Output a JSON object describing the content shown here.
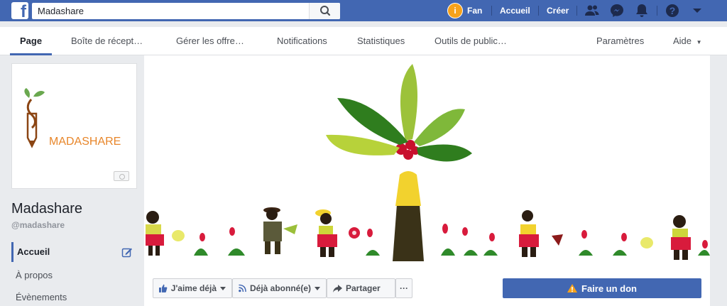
{
  "topbar": {
    "search_value": "Madashare",
    "fan_label": "Fan",
    "home_label": "Accueil",
    "create_label": "Créer"
  },
  "tabs": [
    {
      "label": "Page"
    },
    {
      "label": "Boîte de récept…"
    },
    {
      "label": "Gérer les offre…"
    },
    {
      "label": "Notifications"
    },
    {
      "label": "Statistiques"
    },
    {
      "label": "Outils de public…"
    },
    {
      "label": "Paramètres"
    },
    {
      "label": "Aide"
    }
  ],
  "profile": {
    "logo_text": "MADASHARE",
    "name": "Madashare",
    "handle": "@madashare"
  },
  "sidebar": {
    "items": [
      {
        "label": "Accueil"
      },
      {
        "label": "À propos"
      },
      {
        "label": "Évènements"
      }
    ]
  },
  "actions": {
    "like_label": "J'aime déjà",
    "follow_label": "Déjà abonné(e)",
    "share_label": "Partager",
    "more_label": "···",
    "donate_label": "Faire un don"
  },
  "colors": {
    "brand": "#4267b2",
    "logo_orange": "#e8862a",
    "warning": "#f7a21b"
  }
}
